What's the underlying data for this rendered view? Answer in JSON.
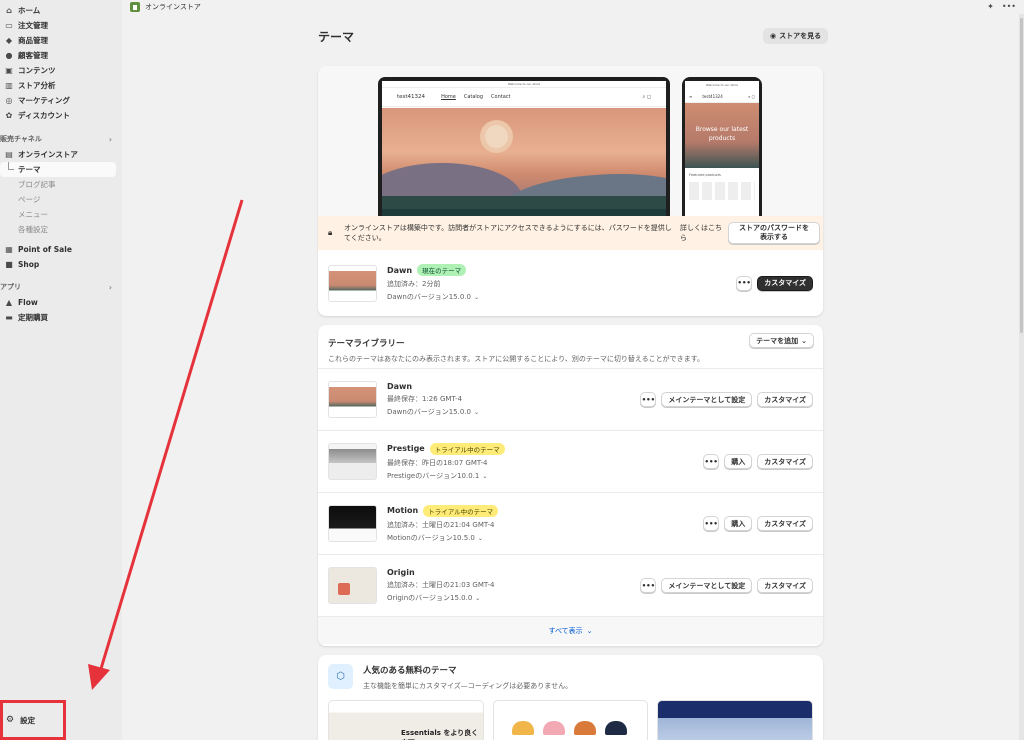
{
  "topbar": {
    "title": "オンラインストア"
  },
  "sidebar": {
    "items": [
      {
        "label": "ホーム",
        "icon": "home-icon"
      },
      {
        "label": "注文管理",
        "icon": "inbox-icon"
      },
      {
        "label": "商品管理",
        "icon": "tag-icon"
      },
      {
        "label": "顧客管理",
        "icon": "person-icon"
      },
      {
        "label": "コンテンツ",
        "icon": "image-icon"
      },
      {
        "label": "ストア分析",
        "icon": "chart-icon"
      },
      {
        "label": "マーケティング",
        "icon": "target-icon"
      },
      {
        "label": "ディスカウント",
        "icon": "discount-icon"
      }
    ],
    "sales_channels_label": "販売チャネル",
    "online_store_label": "オンラインストア",
    "sub_items": [
      "テーマ",
      "ブログ記事",
      "ページ",
      "メニュー",
      "各種設定"
    ],
    "channels": [
      "Point of Sale",
      "Shop"
    ],
    "apps_label": "アプリ",
    "apps": [
      "Flow",
      "定期購買"
    ],
    "settings_label": "設定"
  },
  "page": {
    "title": "テーマ",
    "view_store": "ストアを見る"
  },
  "preview": {
    "store_name": "test41324",
    "nav": [
      "Home",
      "Catalog",
      "Contact"
    ],
    "announcement": "Welcome to our store",
    "phone_headline": "Browse our latest products",
    "phone_featured": "Featured products"
  },
  "notice": {
    "message": "オンラインストアは構築中です。訪問者がストアにアクセスできるようにするには、パスワードを提供してください。",
    "learn_more": "詳しくはこちら",
    "button": "ストアのパスワードを表示する"
  },
  "current_theme": {
    "name": "Dawn",
    "badge": "現在のテーマ",
    "meta": "追加済み：2分前",
    "version": "Dawnのバージョン15.0.0",
    "customize": "カスタマイズ"
  },
  "library": {
    "title": "テーマライブラリー",
    "subtitle": "これらのテーマはあなたにのみ表示されます。ストアに公開することにより、別のテーマに切り替えることができます。",
    "add_theme": "テーマを追加",
    "themes": [
      {
        "name": "Dawn",
        "badge": "",
        "meta": "最終保存：1:26 GMT-4",
        "version": "Dawnのバージョン15.0.0",
        "primary": "メインテーマとして設定",
        "customize": "カスタマイズ"
      },
      {
        "name": "Prestige",
        "badge": "トライアル中のテーマ",
        "meta": "最終保存：昨日の18:07 GMT-4",
        "version": "Prestigeのバージョン10.0.1",
        "primary": "購入",
        "customize": "カスタマイズ"
      },
      {
        "name": "Motion",
        "badge": "トライアル中のテーマ",
        "meta": "追加済み：土曜日の21:04 GMT-4",
        "version": "Motionのバージョン10.5.0",
        "primary": "購入",
        "customize": "カスタマイズ"
      },
      {
        "name": "Origin",
        "badge": "",
        "meta": "追加済み：土曜日の21:03 GMT-4",
        "version": "Originのバージョン15.0.0",
        "primary": "メインテーマとして設定",
        "customize": "カスタマイズ"
      }
    ],
    "view_all": "すべて表示"
  },
  "free_themes": {
    "title": "人気のある無料のテーマ",
    "subtitle": "主な機能を簡単にカスタマイズ—コーディングは必要ありません。",
    "card1_text": "Essentials をより良く実現。"
  },
  "colors": {
    "annotation_red": "#e5323b",
    "badge_green": "#aff0b5",
    "badge_yellow": "#ffeb78",
    "notice_bg": "#fff1e3",
    "link_blue": "#005bd3"
  }
}
